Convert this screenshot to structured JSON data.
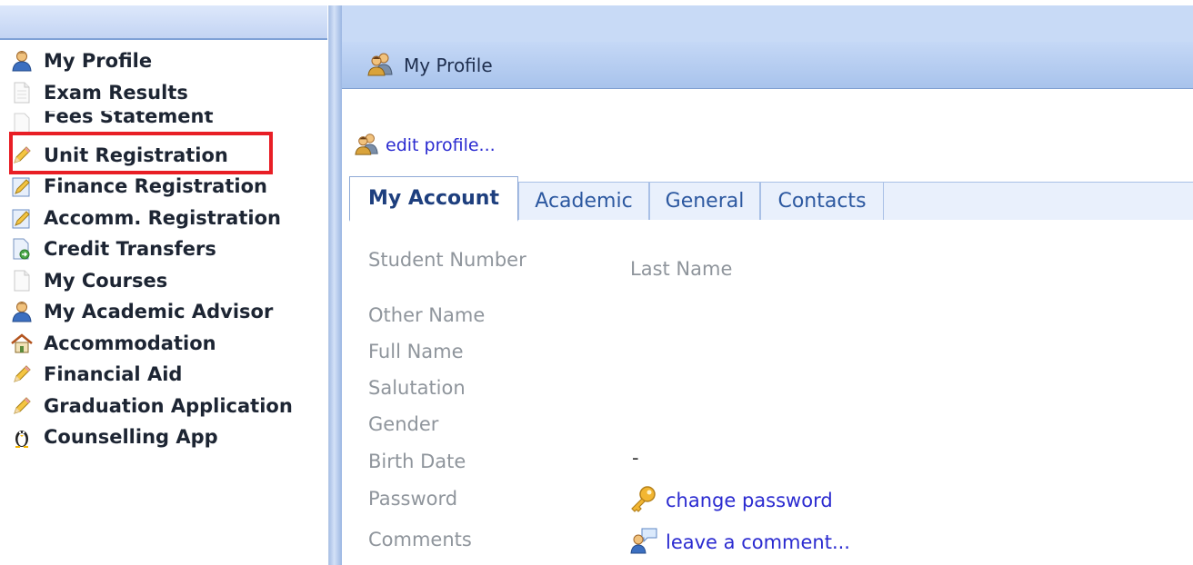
{
  "sidebar": {
    "items": [
      {
        "label": "My Profile",
        "icon": "user-icon"
      },
      {
        "label": "Exam Results",
        "icon": "document-icon"
      },
      {
        "label": "Fees Statement",
        "icon": "document-icon"
      },
      {
        "label": "Unit Registration",
        "icon": "pencil-icon"
      },
      {
        "label": "Finance Registration",
        "icon": "edit-form-icon"
      },
      {
        "label": "Accomm. Registration",
        "icon": "edit-form-icon"
      },
      {
        "label": "Credit Transfers",
        "icon": "transfer-document-icon"
      },
      {
        "label": "My Courses",
        "icon": "document-icon"
      },
      {
        "label": "My Academic Advisor",
        "icon": "user-icon"
      },
      {
        "label": "Accommodation",
        "icon": "house-icon"
      },
      {
        "label": "Financial Aid",
        "icon": "pencil-icon"
      },
      {
        "label": "Graduation Application",
        "icon": "pencil-icon"
      },
      {
        "label": "Counselling App",
        "icon": "penguin-icon"
      }
    ],
    "highlight_color": "#e81e25"
  },
  "panel": {
    "title": "My Profile",
    "edit_link": "edit profile...",
    "tabs": [
      "My Account",
      "Academic",
      "General",
      "Contacts"
    ],
    "active_tab": "My Account",
    "fields": {
      "student_number": "Student Number",
      "last_name": "Last Name",
      "other_name": "Other Name",
      "full_name": "Full Name",
      "salutation": "Salutation",
      "gender": "Gender",
      "birth_date": "Birth Date",
      "birth_date_value": "-",
      "password": "Password",
      "comments": "Comments"
    },
    "change_password_link": "change password",
    "leave_comment_link": "leave a comment..."
  },
  "colors": {
    "header_blue": "#c5d8f6",
    "link_blue": "#2a2ad0",
    "label_gray": "#8f959c"
  }
}
